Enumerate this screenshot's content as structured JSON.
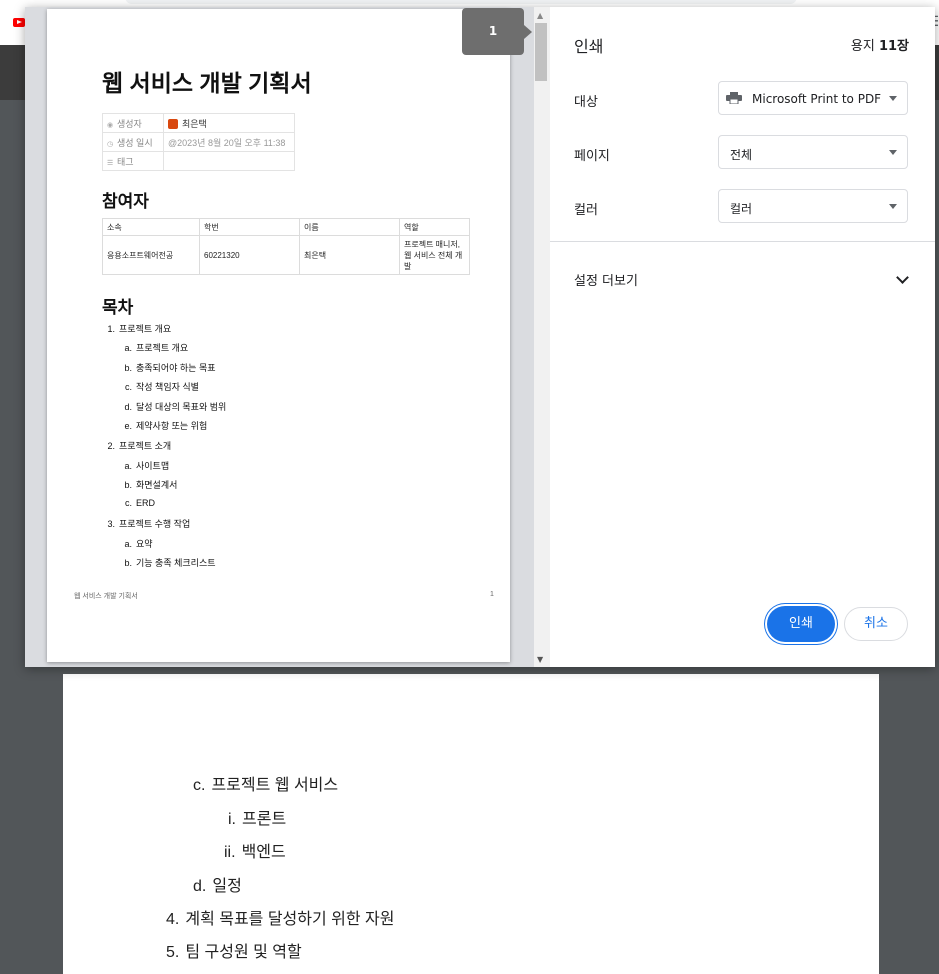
{
  "colors": {
    "accent": "#1a73e8",
    "backdrop": "#525659"
  },
  "browser": {
    "menu_glyph": "☰"
  },
  "preview": {
    "page_badge": "1",
    "doc_title": "웹 서비스 개발 기획서",
    "properties": [
      {
        "icon": "person-icon",
        "key": "생성자",
        "value": "최은택",
        "avatar_text": "은택"
      },
      {
        "icon": "clock-icon",
        "key": "생성 일시",
        "value": "@2023년 8월 20일 오후 11:38"
      },
      {
        "icon": "list-icon",
        "key": "태그",
        "value": ""
      }
    ],
    "members_heading": "참여자",
    "members_table": {
      "headers": [
        "소속",
        "학번",
        "이름",
        "역할"
      ],
      "rows": [
        [
          "응용소프트웨어전공",
          "60221320",
          "최은택",
          "프로젝트 매니저, 웹 서비스 전체 개발"
        ]
      ]
    },
    "toc_heading": "목차",
    "toc": [
      {
        "marker": "1.",
        "text": "프로젝트 개요",
        "level": 1
      },
      {
        "marker": "a.",
        "text": "프로젝트 개요",
        "level": 2
      },
      {
        "marker": "b.",
        "text": "충족되어야 하는 목표",
        "level": 2
      },
      {
        "marker": "c.",
        "text": "작성 책임자 식별",
        "level": 2
      },
      {
        "marker": "d.",
        "text": "달성 대상의 목표와 범위",
        "level": 2
      },
      {
        "marker": "e.",
        "text": "제약사항 또는 위험",
        "level": 2
      },
      {
        "marker": "2.",
        "text": "프로젝트 소개",
        "level": 1
      },
      {
        "marker": "a.",
        "text": "사이트맵",
        "level": 2
      },
      {
        "marker": "b.",
        "text": "화면설계서",
        "level": 2
      },
      {
        "marker": "c.",
        "text": "ERD",
        "level": 2
      },
      {
        "marker": "3.",
        "text": "프로젝트 수행 작업",
        "level": 1
      },
      {
        "marker": "a.",
        "text": "요약",
        "level": 2
      },
      {
        "marker": "b.",
        "text": "기능 충족 체크리스트",
        "level": 2
      }
    ],
    "footer_left": "웹 서비스 개발 기획서",
    "footer_right": "1"
  },
  "settings": {
    "title": "인쇄",
    "sheets_prefix": "용지 ",
    "sheets_count": "11장",
    "destination": {
      "label": "대상",
      "value": "Microsoft Print to PDF",
      "icon": "printer-icon"
    },
    "pages": {
      "label": "페이지",
      "value": "전체"
    },
    "color": {
      "label": "컬러",
      "value": "컬러"
    },
    "more_settings": "설정 더보기",
    "print_button": "인쇄",
    "cancel_button": "취소"
  },
  "background_doc": {
    "items": [
      {
        "marker": "c.",
        "text": "프로젝트 웹 서비스"
      },
      {
        "marker": "i.",
        "text": "프론트"
      },
      {
        "marker": "ii.",
        "text": "백엔드"
      },
      {
        "marker": "d.",
        "text": "일정"
      },
      {
        "marker": "4.",
        "text": "계획 목표를 달성하기 위한 자원"
      },
      {
        "marker": "5.",
        "text": "팀 구성원 및 역할"
      }
    ]
  }
}
